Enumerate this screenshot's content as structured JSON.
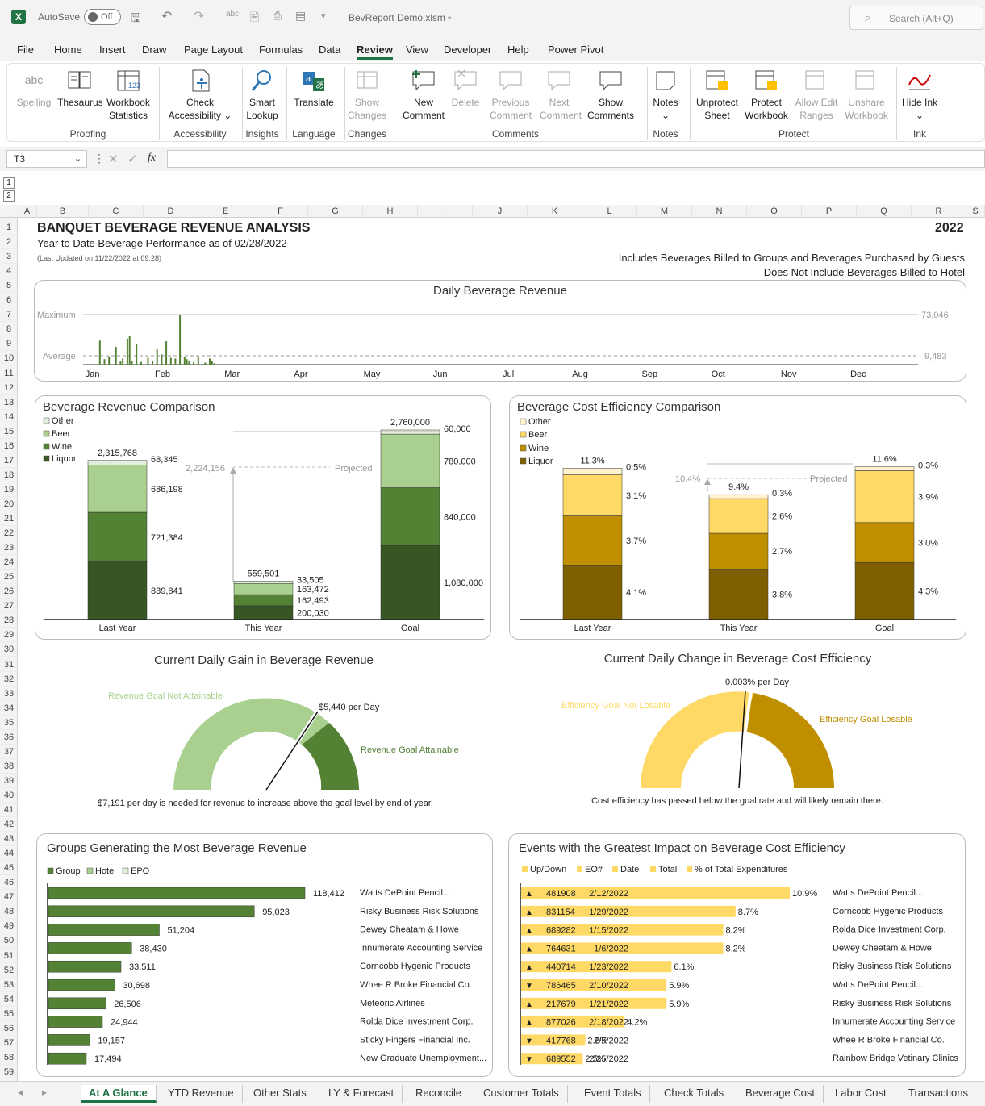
{
  "titlebar": {
    "autosave": "AutoSave",
    "autosave_state": "Off",
    "filename": "BevReport Demo.xlsm",
    "search_placeholder": "Search (Alt+Q)"
  },
  "menu": [
    "File",
    "Home",
    "Insert",
    "Draw",
    "Page Layout",
    "Formulas",
    "Data",
    "Review",
    "View",
    "Developer",
    "Help",
    "Power Pivot"
  ],
  "ribbon": {
    "spelling": "Spelling",
    "spelling_icon_text": "abc",
    "thesaurus": "Thesaurus",
    "workbook_stats": "Workbook Statistics",
    "proofing": "Proofing",
    "check_access": "Check Accessibility",
    "accessibility": "Accessibility",
    "smart_lookup": "Smart Lookup",
    "insights": "Insights",
    "translate": "Translate",
    "language": "Language",
    "show_changes": "Show Changes",
    "changes": "Changes",
    "new_comment": "New Comment",
    "delete": "Delete",
    "prev_comment": "Previous Comment",
    "next_comment": "Next Comment",
    "show_comments": "Show Comments",
    "comments": "Comments",
    "notes": "Notes",
    "notes_group": "Notes",
    "unprotect_sheet": "Unprotect Sheet",
    "protect_workbook": "Protect Workbook",
    "allow_edit": "Allow Edit Ranges",
    "unshare": "Unshare Workbook",
    "protect": "Protect",
    "hide_ink": "Hide Ink",
    "ink": "Ink"
  },
  "formula": {
    "namebox": "T3",
    "fx": "fx"
  },
  "columns": [
    "A",
    "B",
    "C",
    "D",
    "E",
    "F",
    "G",
    "H",
    "I",
    "J",
    "K",
    "L",
    "M",
    "N",
    "O",
    "P",
    "Q",
    "R",
    "S"
  ],
  "outline": [
    "1",
    "2"
  ],
  "sheet": {
    "title": "BANQUET BEVERAGE REVENUE ANALYSIS",
    "year": "2022",
    "subtitle": "Year to Date Beverage Performance as of 02/28/2022",
    "updated": "(Last Updated on 11/22/2022 at 09:28)",
    "note1": "Includes Beverages Billed to Groups and Beverages Purchased by Guests",
    "note2": "Does Not Include Beverages Billed to Hotel"
  },
  "daily": {
    "title": "Daily Beverage Revenue",
    "max_label": "Maximum",
    "avg_label": "Average",
    "max_value": "73,046",
    "avg_value": "9,483",
    "months": [
      "Jan",
      "Feb",
      "Mar",
      "Apr",
      "May",
      "Jun",
      "Jul",
      "Aug",
      "Sep",
      "Oct",
      "Nov",
      "Dec"
    ]
  },
  "chart_data": [
    {
      "type": "bar",
      "title": "Daily Beverage Revenue",
      "ylim": [
        0,
        73046
      ],
      "avg": 9483,
      "x": [
        "1/8",
        "1/10",
        "1/12",
        "1/15",
        "1/17",
        "1/18",
        "1/20",
        "1/21",
        "1/22",
        "1/24",
        "1/26",
        "1/29",
        "1/31",
        "2/2",
        "2/4",
        "2/6",
        "2/8",
        "2/10",
        "2/12",
        "2/14",
        "2/15",
        "2/16",
        "2/18",
        "2/20",
        "2/23",
        "2/25",
        "2/26",
        "2/27"
      ],
      "values": [
        35000,
        8000,
        12000,
        26000,
        5000,
        9000,
        38000,
        42000,
        6000,
        30000,
        4000,
        10000,
        6000,
        22000,
        15000,
        34000,
        10000,
        9000,
        73046,
        11000,
        8000,
        6000,
        4000,
        12000,
        3000,
        9000,
        5000,
        2000
      ]
    },
    {
      "type": "bar",
      "title": "Beverage Revenue Comparison",
      "categories": [
        "Last Year",
        "This Year",
        "Goal"
      ],
      "series": [
        {
          "name": "Liquor",
          "values": [
            839841,
            200030,
            1080000
          ]
        },
        {
          "name": "Wine",
          "values": [
            721384,
            162493,
            840000
          ]
        },
        {
          "name": "Beer",
          "values": [
            686198,
            163472,
            780000
          ]
        },
        {
          "name": "Other",
          "values": [
            68345,
            33505,
            60000
          ]
        }
      ],
      "totals": [
        2315768,
        559501,
        2760000
      ],
      "projected": 2224156
    },
    {
      "type": "bar",
      "title": "Beverage Cost Efficiency Comparison",
      "categories": [
        "Last Year",
        "This Year",
        "Goal"
      ],
      "series": [
        {
          "name": "Liquor",
          "values": [
            4.1,
            3.8,
            4.3
          ]
        },
        {
          "name": "Wine",
          "values": [
            3.7,
            2.7,
            3.0
          ]
        },
        {
          "name": "Beer",
          "values": [
            3.1,
            2.6,
            3.9
          ]
        },
        {
          "name": "Other",
          "values": [
            0.5,
            0.3,
            0.3
          ]
        }
      ],
      "totals": [
        11.3,
        9.4,
        11.6
      ],
      "projected": 10.4
    },
    {
      "type": "pie",
      "title": "Current Daily Gain in Beverage Revenue",
      "values": [
        78,
        22
      ]
    },
    {
      "type": "pie",
      "title": "Current Daily Change in Beverage Cost Efficiency",
      "values": [
        55,
        45
      ]
    },
    {
      "type": "bar",
      "title": "Groups Generating the Most Beverage Revenue",
      "categories": [
        "Watts DePoint Pencil...",
        "Risky Business Risk Solutions",
        "Dewey Cheatam & Howe",
        "Innumerate Accounting Service",
        "Corncobb Hygenic Products",
        "Whee R Broke Financial Co.",
        "Meteoric Airlines",
        "Rolda Dice Investment Corp.",
        "Sticky Fingers Financial Inc.",
        "New Graduate Unemployment..."
      ],
      "values": [
        118412,
        95023,
        51204,
        38430,
        33511,
        30698,
        26506,
        24944,
        19157,
        17494
      ]
    },
    {
      "type": "bar",
      "title": "Events with the Greatest Impact on Beverage Cost Efficiency",
      "values": [
        10.9,
        8.7,
        8.2,
        8.2,
        6.1,
        5.9,
        5.9,
        4.2,
        2.6,
        2.5
      ]
    }
  ],
  "rev": {
    "title": "Beverage Revenue Comparison",
    "legend": [
      "Other",
      "Beer",
      "Wine",
      "Liquor"
    ],
    "totals": [
      "2,315,768",
      "559,501",
      "2,760,000"
    ],
    "projected": "2,224,156",
    "projected_label": "Projected",
    "ly": [
      "68,345",
      "686,198",
      "721,384",
      "839,841"
    ],
    "ty": [
      "33,505",
      "163,472",
      "162,493",
      "200,030"
    ],
    "goal": [
      "60,000",
      "780,000",
      "840,000",
      "1,080,000"
    ],
    "cats": [
      "Last Year",
      "This Year",
      "Goal"
    ]
  },
  "eff": {
    "title": "Beverage Cost Efficiency Comparison",
    "legend": [
      "Other",
      "Beer",
      "Wine",
      "Liquor"
    ],
    "totals": [
      "11.3%",
      "9.4%",
      "11.6%"
    ],
    "projected": "10.4%",
    "projected_label": "Projected",
    "ly": [
      "0.5%",
      "3.1%",
      "3.7%",
      "4.1%"
    ],
    "ty": [
      "0.3%",
      "2.6%",
      "2.7%",
      "3.8%"
    ],
    "goal": [
      "0.3%",
      "3.9%",
      "3.0%",
      "4.3%"
    ],
    "cats": [
      "Last Year",
      "This Year",
      "Goal"
    ]
  },
  "gauge1": {
    "title": "Current Daily Gain in Beverage Revenue",
    "not_attainable": "Revenue Goal Not Attainable",
    "attainable": "Revenue Goal Attainable",
    "per_day": "$5,440 per Day",
    "note": "$7,191 per day is needed for revenue to increase above the goal level by end of year."
  },
  "gauge2": {
    "title": "Current Daily Change in Beverage Cost Efficiency",
    "not_losable": "Efficiency Goal Not Losable",
    "losable": "Efficiency Goal Losable",
    "per_day": "0.003% per Day",
    "note": "Cost efficiency has passed below the goal rate and will likely remain there."
  },
  "groups": {
    "title": "Groups Generating the Most Beverage Revenue",
    "legend": [
      "Group",
      "Hotel",
      "EPO"
    ],
    "names": [
      "Watts DePoint Pencil...",
      "Risky Business Risk Solutions",
      "Dewey Cheatam & Howe",
      "Innumerate Accounting Service",
      "Corncobb Hygenic Products",
      "Whee R Broke Financial Co.",
      "Meteoric Airlines",
      "Rolda Dice Investment Corp.",
      "Sticky Fingers Financial Inc.",
      "New Graduate Unemployment..."
    ],
    "labels": [
      "118,412",
      "95,023",
      "51,204",
      "38,430",
      "33,511",
      "30,698",
      "26,506",
      "24,944",
      "19,157",
      "17,494"
    ]
  },
  "events": {
    "title": "Events with the Greatest Impact on Beverage Cost Efficiency",
    "legend": [
      "Up/Down",
      "EO#",
      "Date",
      "Total",
      "% of Total Expenditures"
    ],
    "arrows": [
      "▲",
      "▲",
      "▲",
      "▲",
      "▲",
      "▼",
      "▲",
      "▲",
      "▼",
      "▼"
    ],
    "eo": [
      "481908",
      "831154",
      "689282",
      "764631",
      "440714",
      "786465",
      "217679",
      "877026",
      "417768",
      "689552"
    ],
    "dates": [
      "2/12/2022",
      "1/29/2022",
      "1/15/2022",
      "1/6/2022",
      "1/23/2022",
      "2/10/2022",
      "1/21/2022",
      "2/18/2022",
      "2/5/2022",
      "2/25/2022"
    ],
    "pct": [
      "10.9%",
      "8.7%",
      "8.2%",
      "8.2%",
      "6.1%",
      "5.9%",
      "5.9%",
      "4.2%",
      "2.6%",
      "2.5%"
    ],
    "names": [
      "Watts DePoint Pencil...",
      "Corncobb Hygenic Products",
      "Rolda Dice Investment Corp.",
      "Dewey Cheatam & Howe",
      "Risky Business Risk Solutions",
      "Watts DePoint Pencil...",
      "Risky Business Risk Solutions",
      "Innumerate Accounting Service",
      "Whee R Broke Financial Co.",
      "Rainbow Bridge Vetinary Clinics"
    ]
  },
  "tabs": [
    "At A Glance",
    "YTD Revenue",
    "Other Stats",
    "LY & Forecast",
    "Reconcile",
    "Customer Totals",
    "Event Totals",
    "Check Totals",
    "Beverage Cost",
    "Labor Cost",
    "Transactions"
  ],
  "colors": {
    "excel_green": "#217346",
    "liquor": "#375623",
    "wine": "#548235",
    "beer": "#a9d08e",
    "other": "#e2efda",
    "eff_liquor": "#7f6000",
    "eff_wine": "#bf8f00",
    "eff_beer": "#ffd966",
    "eff_other": "#fff2cc"
  }
}
